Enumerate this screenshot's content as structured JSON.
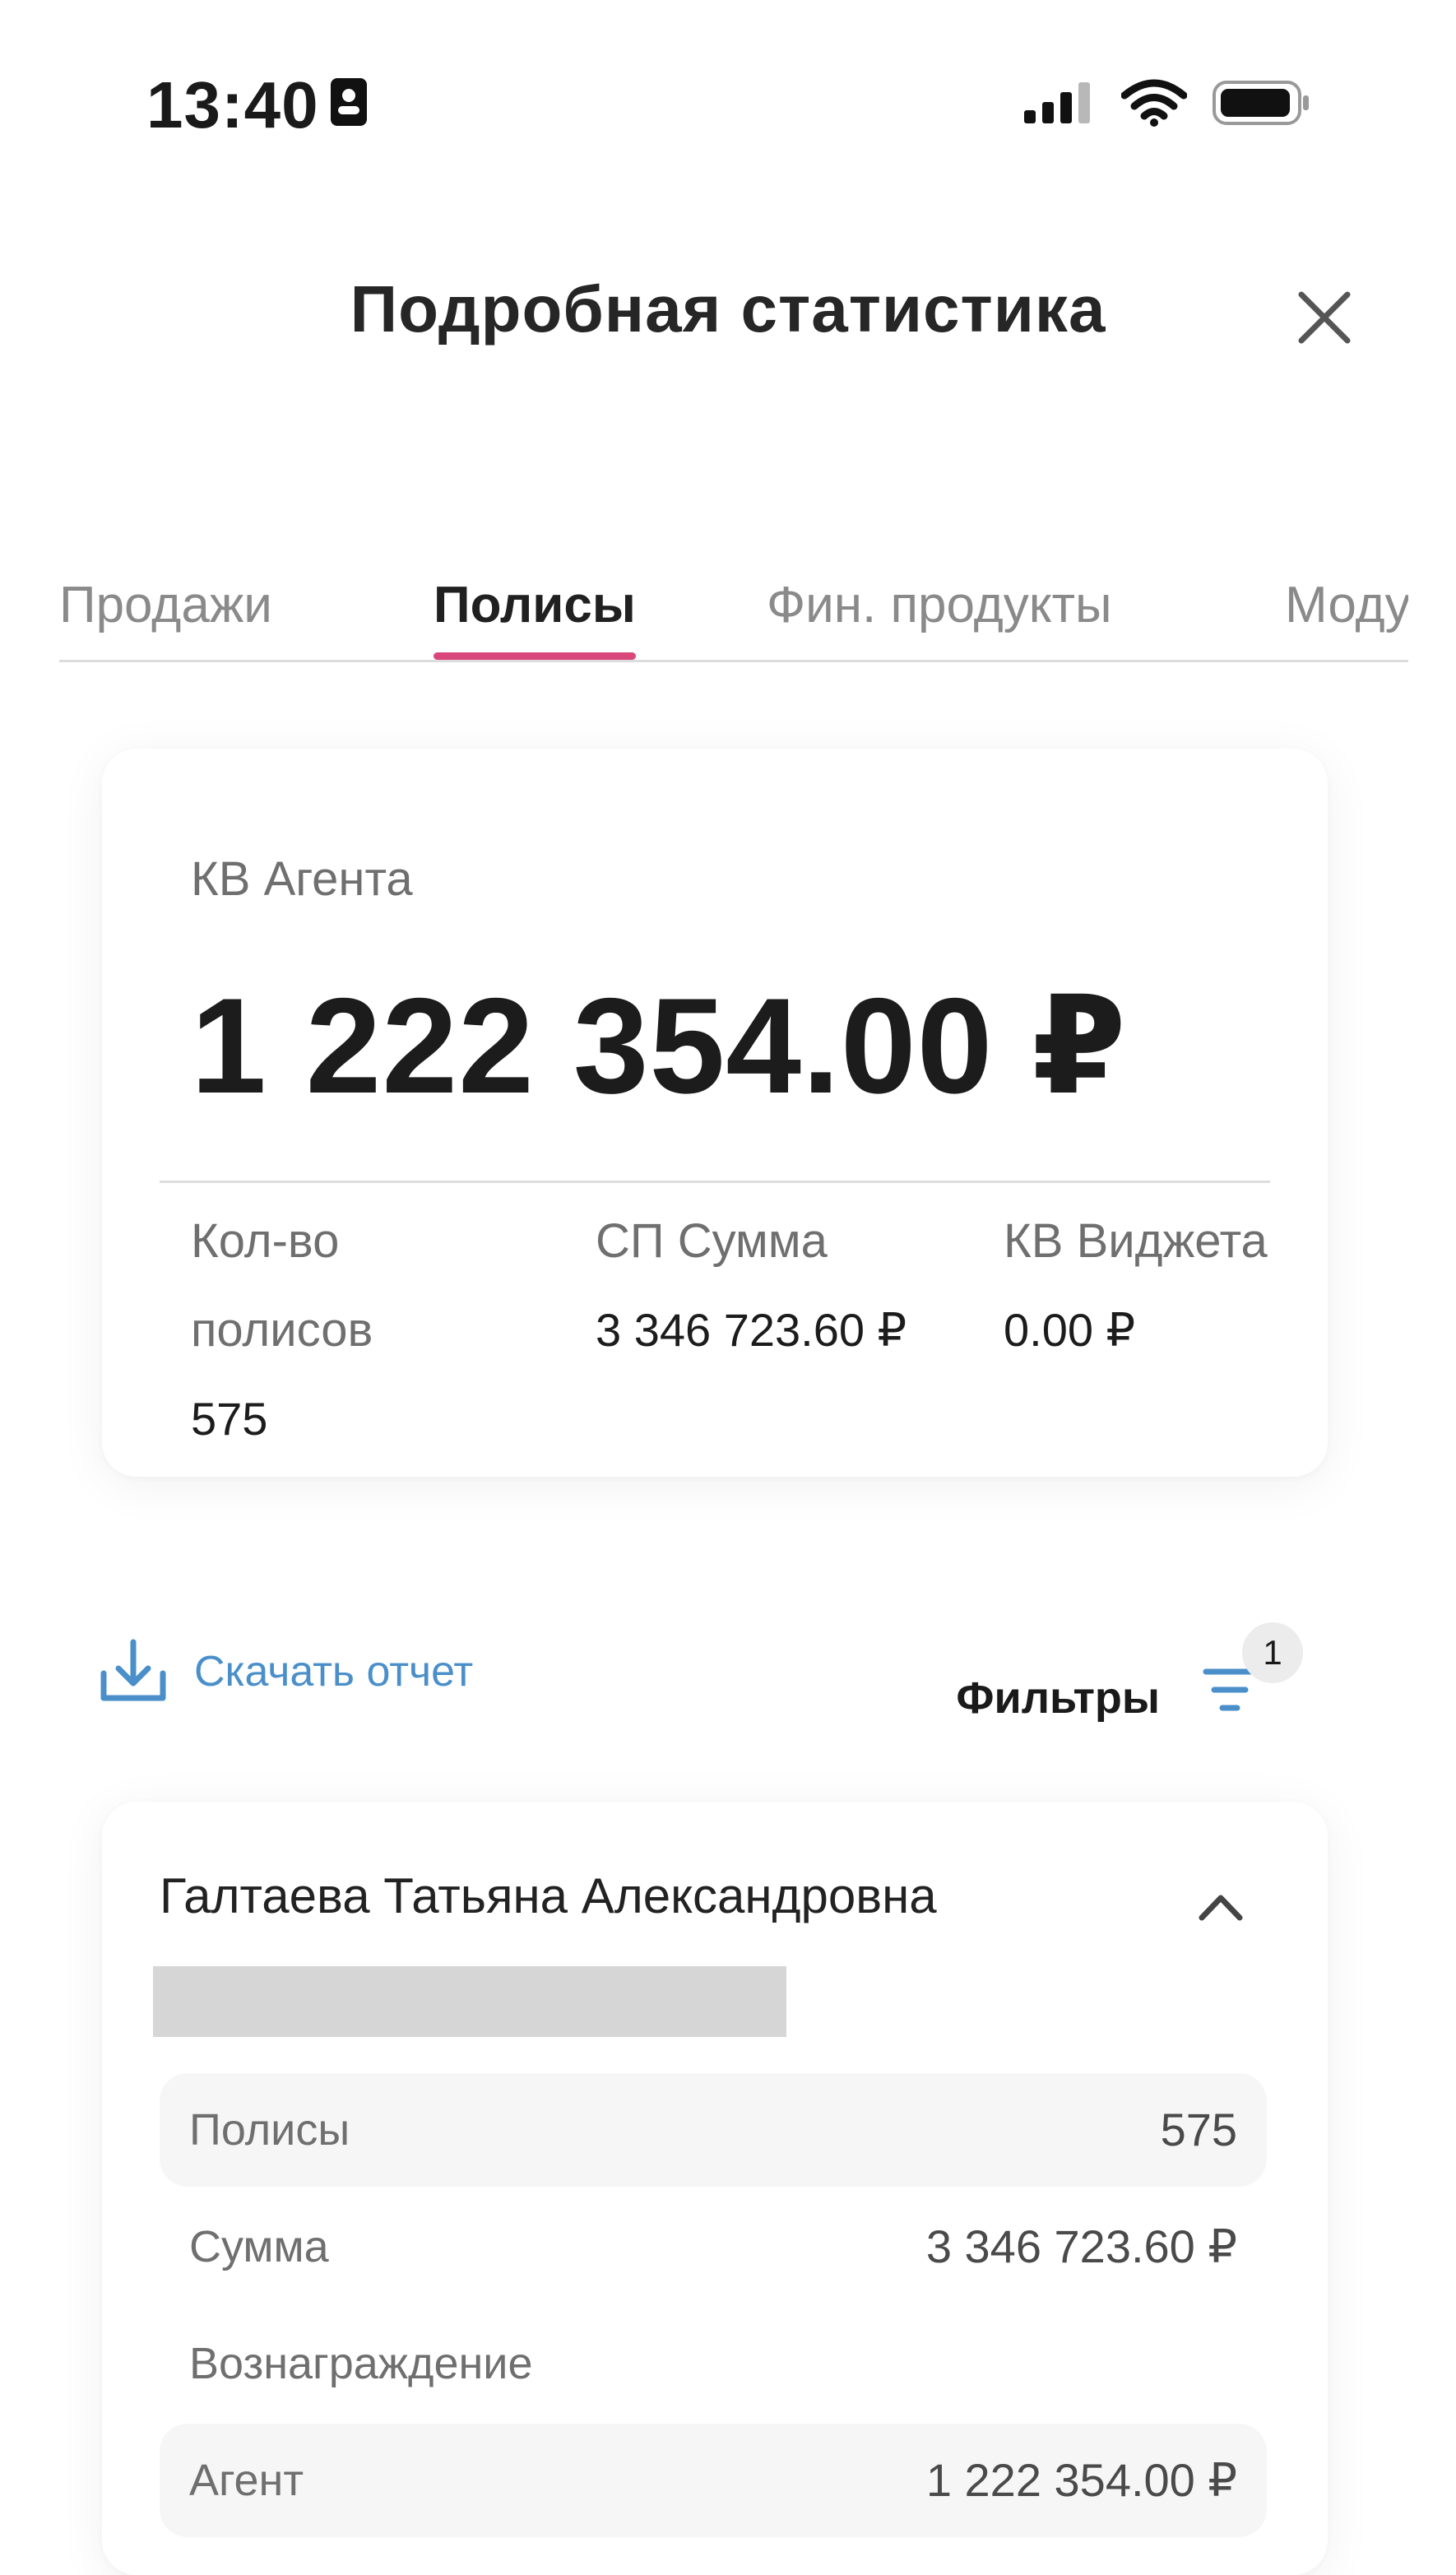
{
  "status_bar": {
    "time": "13:40",
    "icons": [
      "person-card-icon",
      "cellular-signal-icon",
      "wifi-icon",
      "battery-icon"
    ]
  },
  "header": {
    "title": "Подробная статистика",
    "close_icon": "close-icon"
  },
  "tabs": [
    {
      "label": "Продажи",
      "active": false
    },
    {
      "label": "Полисы",
      "active": true
    },
    {
      "label": "Фин. продукты",
      "active": false
    },
    {
      "label": "Моду",
      "active": false
    }
  ],
  "summary": {
    "kv_label": "КВ Агента",
    "kv_value": "1 222 354.00 ₽",
    "stats": [
      {
        "label_line1": "Кол-во",
        "label_line2": "полисов",
        "value": "575"
      },
      {
        "label": "СП Сумма",
        "value": "3 346 723.60 ₽"
      },
      {
        "label": "КВ Виджета",
        "value": "0.00 ₽"
      }
    ]
  },
  "actions": {
    "download_label": "Скачать отчет",
    "filters_label": "Фильтры",
    "filters_count": "1"
  },
  "agent": {
    "name": "Галтаева Татьяна Александровна",
    "rows": [
      {
        "label": "Полисы",
        "value": "575"
      },
      {
        "label": "Сумма",
        "value": "3 346 723.60 ₽"
      },
      {
        "label": "Вознаграждение",
        "value": ""
      },
      {
        "label": "Агент",
        "value": "1 222 354.00 ₽"
      }
    ]
  },
  "colors": {
    "accent_tab": "#d9467a",
    "link_blue": "#4a8fca",
    "text_dark": "#1c1c1c",
    "text_gray": "#6f6f6f"
  }
}
